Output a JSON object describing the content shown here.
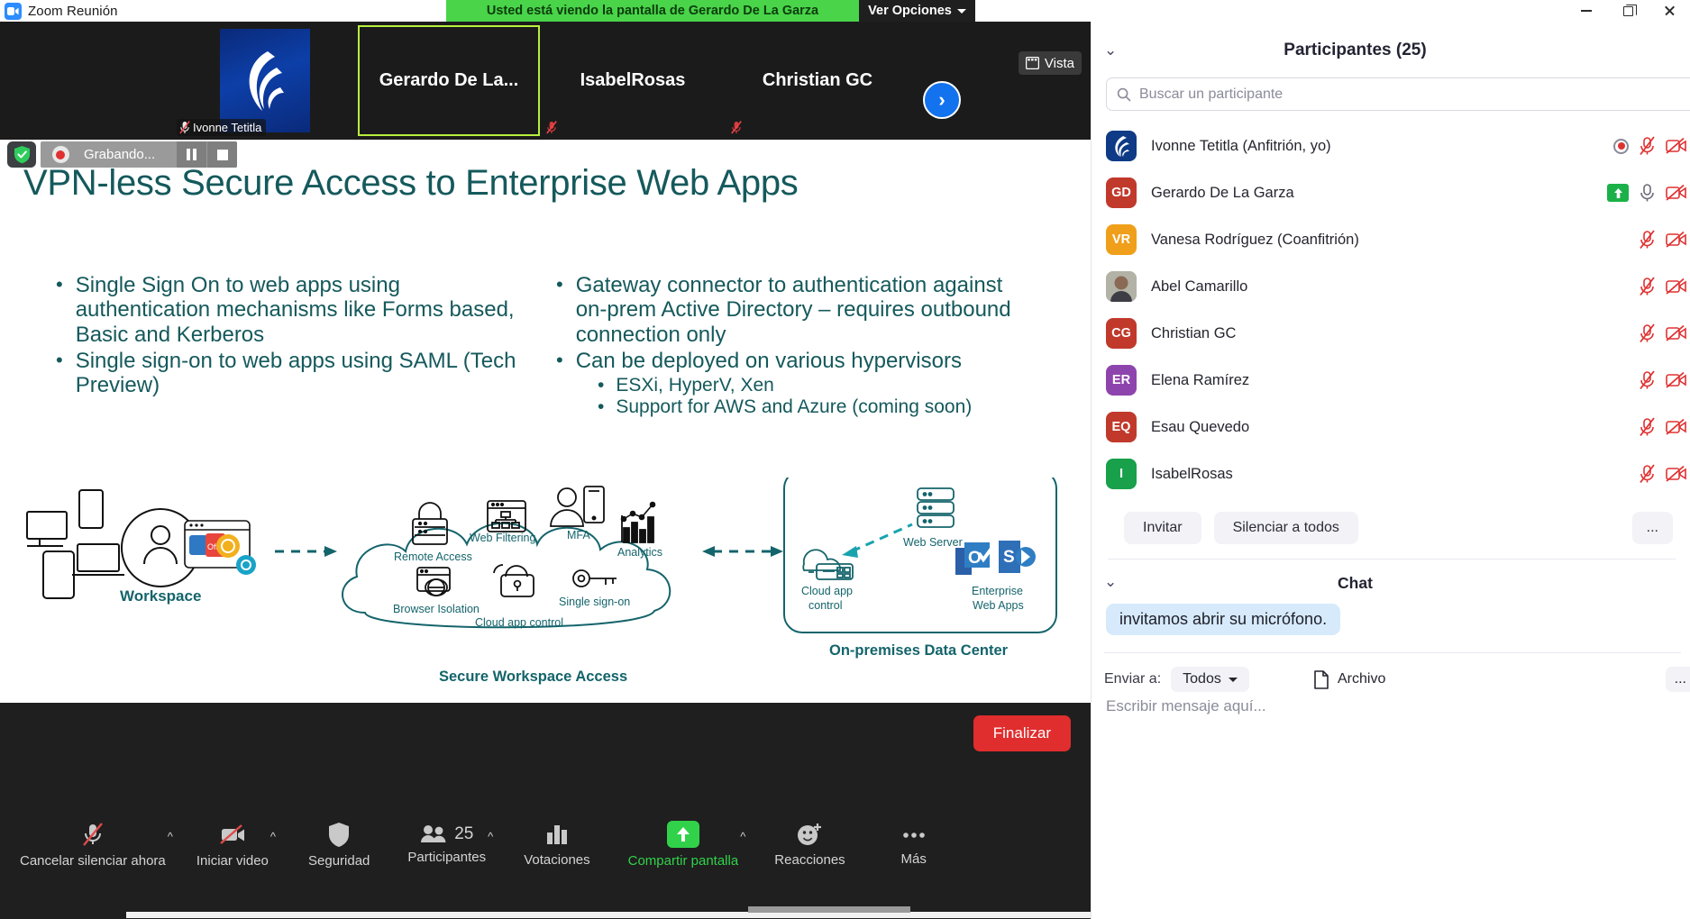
{
  "window": {
    "app_title": "Zoom Reunión",
    "share_banner": "Usted está viendo la pantalla de Gerardo De La Garza",
    "view_options": "Ver Opciones",
    "minimize_icon": "minimize-icon",
    "restore_icon": "restore-icon",
    "close_icon": "close-icon"
  },
  "filmstrip": {
    "vista_label": "Vista",
    "next_arrow": "›",
    "tiles": [
      {
        "name": "Ivonne Tetitla",
        "type": "avatar-image",
        "muted": true,
        "active": false
      },
      {
        "name": "Gerardo De La...",
        "type": "name",
        "muted": false,
        "active": true
      },
      {
        "name": "IsabelRosas",
        "type": "name",
        "muted": true,
        "active": false
      },
      {
        "name": "Christian GC",
        "type": "name",
        "muted": true,
        "active": false
      }
    ]
  },
  "recording": {
    "security_icon": "shield-icon",
    "label": "Grabando...",
    "pause_icon": "pause-icon",
    "stop_icon": "stop-icon",
    "record_icon": "record-dot-icon"
  },
  "slide": {
    "title": "VPN-less Secure Access to Enterprise Web Apps",
    "accent_color": "#15595c",
    "bullets_left": [
      "Single Sign On to web apps using authentication mechanisms like Forms based, Basic and Kerberos",
      "Single sign-on to web apps using SAML (Tech Preview)"
    ],
    "bullets_right": [
      "Gateway connector to authentication against on-prem Active Directory – requires outbound connection only",
      "Can be deployed on various hypervisors"
    ],
    "bullets_right_sub": [
      "ESXi, HyperV, Xen",
      "Support for AWS and Azure (coming soon)"
    ],
    "diagram": {
      "workspace_label": "Workspace",
      "cloud_title": "Secure Workspace Access",
      "cloud_items": [
        "Remote Access",
        "Web Filtering",
        "MFA",
        "Analytics",
        "Browser Isolation",
        "Cloud app control",
        "Single sign-on"
      ],
      "datacenter_title": "On-premises Data Center",
      "datacenter_items": [
        "Web Server",
        "Cloud app control",
        "Enterprise Web Apps"
      ]
    }
  },
  "toolbar": {
    "items": [
      {
        "label": "Cancelar silenciar ahora",
        "icon": "mic-off-icon",
        "caret": true,
        "active": false
      },
      {
        "label": "Iniciar video",
        "icon": "video-off-icon",
        "caret": true,
        "active": false
      },
      {
        "label": "Seguridad",
        "icon": "shield-icon",
        "caret": false,
        "active": false
      },
      {
        "label": "Participantes",
        "icon": "participants-icon",
        "caret": true,
        "active": false,
        "count": "25"
      },
      {
        "label": "Votaciones",
        "icon": "polls-icon",
        "caret": false,
        "active": false
      },
      {
        "label": "Compartir pantalla",
        "icon": "share-screen-icon",
        "caret": true,
        "active": true
      },
      {
        "label": "Reacciones",
        "icon": "reactions-icon",
        "caret": false,
        "active": false
      },
      {
        "label": "Más",
        "icon": "more-dots-icon",
        "caret": false,
        "active": false
      }
    ],
    "end_button": "Finalizar",
    "end_button_color": "#e02d2d",
    "share_active_color": "#31d24a"
  },
  "participants_panel": {
    "title": "Participantes (25)",
    "collapse_icon": "chevron-down-icon",
    "search_placeholder": "Buscar un participante",
    "search_value": "",
    "search_icon": "search-icon",
    "rows": [
      {
        "name": "Ivonne Tetitla (Anfitrión, yo)",
        "initials": "",
        "avatar_type": "logo",
        "color": "#0e3a86",
        "recording": true,
        "muted": true,
        "video_off": true
      },
      {
        "name": "Gerardo De La Garza",
        "initials": "GD",
        "avatar_type": "initials",
        "color": "#c0392b",
        "sharing": true,
        "muted": false,
        "video_off": true
      },
      {
        "name": "Vanesa Rodríguez (Coanfitrión)",
        "initials": "VR",
        "avatar_type": "initials",
        "color": "#ef9f1a",
        "muted": true,
        "video_off": true
      },
      {
        "name": "Abel Camarillo",
        "initials": "",
        "avatar_type": "photo",
        "color": "#8b8b7a",
        "muted": true,
        "video_off": true
      },
      {
        "name": "Christian GC",
        "initials": "CG",
        "avatar_type": "initials",
        "color": "#c0392b",
        "muted": true,
        "video_off": true
      },
      {
        "name": "Elena Ramírez",
        "initials": "ER",
        "avatar_type": "initials",
        "color": "#8e44ad",
        "muted": true,
        "video_off": true
      },
      {
        "name": "Esau Quevedo",
        "initials": "EQ",
        "avatar_type": "initials",
        "color": "#c0392b",
        "muted": true,
        "video_off": true
      },
      {
        "name": "IsabelRosas",
        "initials": "I",
        "avatar_type": "initials",
        "color": "#18a04a",
        "muted": true,
        "video_off": true
      }
    ],
    "actions": {
      "invite": "Invitar",
      "mute_all": "Silenciar a todos",
      "more": "..."
    }
  },
  "chat_panel": {
    "title": "Chat",
    "collapse_icon": "chevron-down-icon",
    "messages": [
      {
        "text": "invitamos abrir su micrófono."
      }
    ],
    "send_label": "Enviar a:",
    "send_to": "Todos",
    "file_label": "Archivo",
    "file_icon": "file-icon",
    "more_label": "...",
    "input_placeholder": "Escribir mensaje aquí...",
    "input_value": ""
  }
}
